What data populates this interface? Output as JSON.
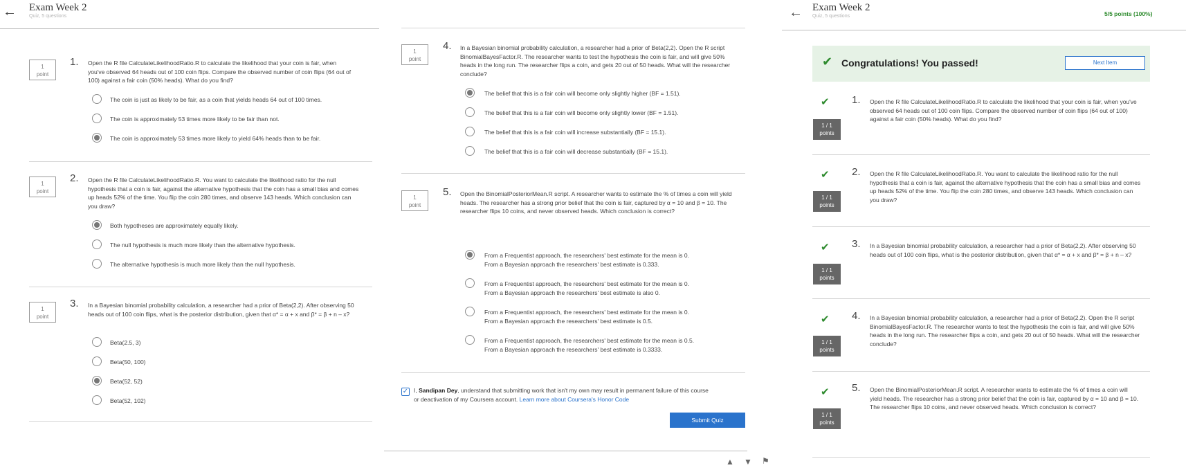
{
  "panel1": {
    "title": "Exam Week 2",
    "subtitle": "Quiz, 5 questions",
    "questions": [
      {
        "number": "1.",
        "points": "1",
        "points_unit": "point",
        "text": "Open the R file CalculateLikelihoodRatio.R to calculate the likelihood that your coin is fair, when you've observed 64 heads out of 100 coin flips. Compare the observed number of coin flips (64 out of 100) against a fair coin (50% heads). What do you find?",
        "options": [
          {
            "label": "The coin is just as likely to be fair, as a coin that yields heads 64 out of 100 times.",
            "selected": false
          },
          {
            "label": "The coin is approximately 53 times more likely to be fair than not.",
            "selected": false
          },
          {
            "label": "The coin is approximately 53 times more likely to yield 64% heads than to be fair.",
            "selected": true
          }
        ]
      },
      {
        "number": "2.",
        "points": "1",
        "points_unit": "point",
        "text": "Open the R file CalculateLikelihoodRatio.R. You want to calculate the likelihood ratio for the null hypothesis that a coin is fair, against the alternative hypothesis that the coin has a small bias and comes up heads 52% of the time. You flip the coin 280 times, and observe 143 heads. Which conclusion can you draw?",
        "options": [
          {
            "label": "Both hypotheses are approximately equally likely.",
            "selected": true
          },
          {
            "label": "The null hypothesis is much more likely than the alternative hypothesis.",
            "selected": false
          },
          {
            "label": "The alternative hypothesis is much more likely than the null hypothesis.",
            "selected": false
          }
        ]
      },
      {
        "number": "3.",
        "points": "1",
        "points_unit": "point",
        "text": "In a Bayesian binomial probability calculation, a researcher had a prior of Beta(2,2). After observing 50 heads out of 100 coin flips, what is the posterior distribution, given that α* = α + x and β* = β + n – x?",
        "options": [
          {
            "label": "Beta(2.5, 3)",
            "selected": false
          },
          {
            "label": "Beta(50, 100)",
            "selected": false
          },
          {
            "label": "Beta(52, 52)",
            "selected": true
          },
          {
            "label": "Beta(52, 102)",
            "selected": false
          }
        ]
      }
    ]
  },
  "panel2": {
    "questions": [
      {
        "number": "4.",
        "points": "1",
        "points_unit": "point",
        "text": "In a Bayesian binomial probability calculation, a researcher had a prior of Beta(2,2). Open the R script BinomialBayesFactor.R. The researcher wants to test the hypothesis the coin is fair, and will give 50% heads in the long run. The researcher flips a coin, and gets 20 out of 50 heads. What will the researcher conclude?",
        "options": [
          {
            "label": "The belief that this is a fair coin will become only slightly higher (BF = 1.51).",
            "selected": true
          },
          {
            "label": "The belief that this is a fair coin will become only slightly lower (BF = 1.51).",
            "selected": false
          },
          {
            "label": "The belief that this is a fair coin will increase substantially (BF = 15.1).",
            "selected": false
          },
          {
            "label": "The belief that this is a fair coin will decrease substantially (BF = 15.1).",
            "selected": false
          }
        ]
      },
      {
        "number": "5.",
        "points": "1",
        "points_unit": "point",
        "text": "Open the BinomialPosteriorMean.R script. A researcher wants to estimate the % of times a coin will yield heads. The researcher has a strong prior belief that the coin is fair, captured by α = 10 and β = 10. The researcher flips 10 coins, and never observed heads. Which conclusion is correct?",
        "options": [
          {
            "line1": "From a Frequentist approach, the researchers' best estimate for the mean is 0.",
            "line2": "From a Bayesian approach the researchers' best estimate is 0.333.",
            "selected": true
          },
          {
            "line1": "From a Frequentist approach, the researchers' best estimate for the mean is 0.",
            "line2": "From a Bayesian approach the researchers' best estimate is also 0.",
            "selected": false
          },
          {
            "line1": "From a Frequentist approach, the researchers' best estimate for the mean is 0.",
            "line2": "From a Bayesian approach the researchers' best estimate is 0.5.",
            "selected": false
          },
          {
            "line1": "From a Frequentist approach, the researchers' best estimate for the mean is 0.5.",
            "line2": "From a Bayesian approach the researchers' best estimate is 0.3333.",
            "selected": false
          }
        ]
      }
    ],
    "honor": {
      "checked": true,
      "prefix": "I, ",
      "name": "Sandipan Dey",
      "line1_rest": ", understand that submitting work that isn't my own may result in permanent failure of this course",
      "line2": "or deactivation of my Coursera account. ",
      "link": "Learn more about Coursera's Honor Code"
    },
    "submit_label": "Submit Quiz",
    "feedback_icons": [
      "thumbs-up-icon",
      "thumbs-down-icon",
      "flag-icon"
    ]
  },
  "panel3": {
    "title": "Exam Week 2",
    "subtitle": "Quiz, 5 questions",
    "score": "5/5 points (100%)",
    "banner": "Congratulations! You passed!",
    "next_label": "Next Item",
    "status_color": "#2e8b2e",
    "results": [
      {
        "number": "1.",
        "score": "1 / 1",
        "unit": "points",
        "text": "Open the R file CalculateLikelihoodRatio.R to calculate the likelihood that your coin is fair, when you've observed 64 heads out of 100 coin flips. Compare the observed number of coin flips (64 out of 100) against a fair coin (50% heads). What do you find?"
      },
      {
        "number": "2.",
        "score": "1 / 1",
        "unit": "points",
        "text": "Open the R file CalculateLikelihoodRatio.R. You want to calculate the likelihood ratio for the null hypothesis that a coin is fair, against the alternative hypothesis that the coin has a small bias and comes up heads 52% of the time. You flip the coin 280 times, and observe 143 heads. Which conclusion can you draw?"
      },
      {
        "number": "3.",
        "score": "1 / 1",
        "unit": "points",
        "text": "In a Bayesian binomial probability calculation, a researcher had a prior of Beta(2,2). After observing 50 heads out of 100 coin flips, what is the posterior distribution, given that α* = α + x and β* = β + n – x?"
      },
      {
        "number": "4.",
        "score": "1 / 1",
        "unit": "points",
        "text": "In a Bayesian binomial probability calculation, a researcher had a prior of Beta(2,2). Open the R script BinomialBayesFactor.R. The researcher wants to test the hypothesis the coin is fair, and will give 50% heads in the long run. The researcher flips a coin, and gets 20 out of 50 heads. What will the researcher conclude?"
      },
      {
        "number": "5.",
        "score": "1 / 1",
        "unit": "points",
        "text": "Open the BinomialPosteriorMean.R script. A researcher wants to estimate the % of times a coin will yield heads. The researcher has a strong prior belief that the coin is fair, captured by α = 10 and β = 10. The researcher flips 10 coins, and never observed heads. Which conclusion is correct?"
      }
    ]
  }
}
